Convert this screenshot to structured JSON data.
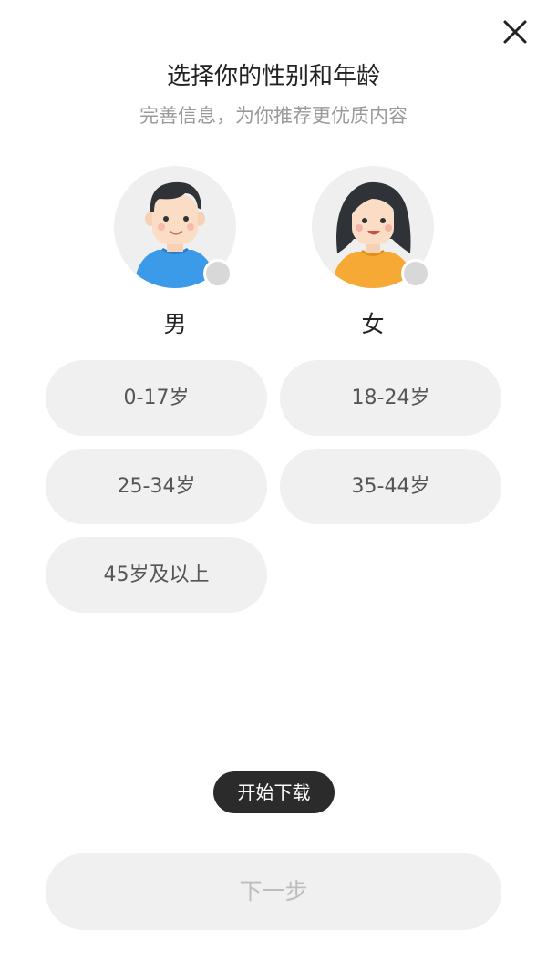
{
  "header": {
    "close_icon": "close-icon",
    "title": "选择你的性别和年龄",
    "subtitle": "完善信息，为你推荐更优质内容"
  },
  "gender": {
    "options": [
      {
        "label": "男",
        "avatar": "male-avatar-icon",
        "selected": false,
        "shirt_color": "#3b9be8"
      },
      {
        "label": "女",
        "avatar": "female-avatar-icon",
        "selected": false,
        "shirt_color": "#f7a935"
      }
    ]
  },
  "age": {
    "options": [
      {
        "label": "0-17岁"
      },
      {
        "label": "18-24岁"
      },
      {
        "label": "25-34岁"
      },
      {
        "label": "35-44岁"
      },
      {
        "label": "45岁及以上"
      }
    ]
  },
  "toast": {
    "text": "开始下载"
  },
  "footer": {
    "next_label": "下一步"
  },
  "colors": {
    "option_background": "#f0f0f0",
    "toast_background": "#2b2b2b",
    "disabled_text": "#bdbdbd"
  }
}
